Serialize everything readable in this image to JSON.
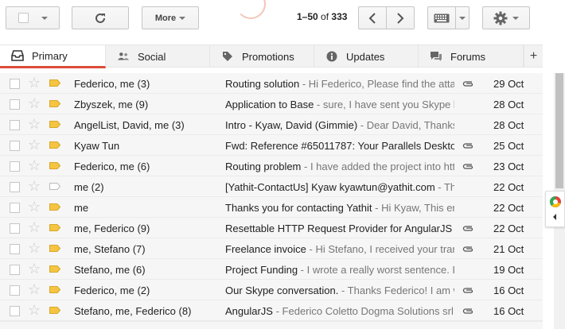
{
  "toolbar": {
    "more_label": "More",
    "pager": {
      "range": "1–50",
      "of_word": "of",
      "total": "333"
    }
  },
  "tabs": [
    {
      "label": "Primary",
      "icon": "inbox-icon"
    },
    {
      "label": "Social",
      "icon": "people-icon"
    },
    {
      "label": "Promotions",
      "icon": "tag-icon"
    },
    {
      "label": "Updates",
      "icon": "info-icon"
    },
    {
      "label": "Forums",
      "icon": "forum-icon"
    }
  ],
  "tab_add_label": "+",
  "emails": [
    {
      "from": "Federico, me (3)",
      "subject": "Routing solution",
      "snippet": " - Hi Federico, Please find the attac",
      "date": "29 Oct",
      "attachment": true,
      "important": true
    },
    {
      "from": "Zbyszek, me (9)",
      "subject": "Application to Base",
      "snippet": " - sure, I have sent you Skype li",
      "date": "28 Oct",
      "attachment": false,
      "important": true
    },
    {
      "from": "AngelList, David, me (3)",
      "subject": "Intro - Kyaw, David (Gimmie)",
      "snippet": " - Dear David, Thanks",
      "date": "28 Oct",
      "attachment": false,
      "important": true
    },
    {
      "from": "Kyaw Tun",
      "subject": "Fwd: Reference #65011787: Your Parallels Deskto",
      "snippet": "",
      "date": "25 Oct",
      "attachment": true,
      "important": true
    },
    {
      "from": "Federico, me (6)",
      "subject": "Routing problem",
      "snippet": " - I have added the project into http",
      "date": "23 Oct",
      "attachment": true,
      "important": true
    },
    {
      "from": "me (2)",
      "subject": "[Yathit-ContactUs] Kyaw kyawtun@yathit.com",
      "snippet": " - Thi",
      "date": "22 Oct",
      "attachment": false,
      "important": false
    },
    {
      "from": "me",
      "subject": "Thanks you for contacting Yathit",
      "snippet": " - Hi Kyaw, This er",
      "date": "22 Oct",
      "attachment": false,
      "important": true
    },
    {
      "from": "me, Federico (9)",
      "subject": "Resettable HTTP Request Provider for AngularJS r",
      "snippet": "",
      "date": "22 Oct",
      "attachment": true,
      "important": true
    },
    {
      "from": "me, Stefano (7)",
      "subject": "Freelance invoice",
      "snippet": " - Hi Stefano, I received your tran",
      "date": "21 Oct",
      "attachment": true,
      "important": true
    },
    {
      "from": "Stefano, me (6)",
      "subject": "Project Funding",
      "snippet": " - I wrote a really worst sentence. I",
      "date": "19 Oct",
      "attachment": false,
      "important": true
    },
    {
      "from": "Federico, me (2)",
      "subject": "Our Skype conversation.",
      "snippet": " - Thanks Federico! I am w",
      "date": "16 Oct",
      "attachment": true,
      "important": true
    },
    {
      "from": "Stefano, me, Federico (8)",
      "subject": "AngularJS",
      "snippet": " - Federico Coletto Dogma Solutions srl",
      "date": "16 Oct",
      "attachment": true,
      "important": true
    }
  ],
  "colors": {
    "accent": "#dd4b39",
    "important": "#f5c542",
    "row_bg": "#f6f6f6"
  }
}
